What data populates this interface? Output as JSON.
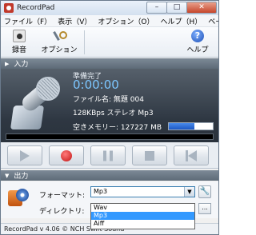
{
  "window": {
    "title": "RecordPad",
    "controls": {
      "minimize": "–",
      "maximize": "□",
      "close": "✕"
    }
  },
  "menu": [
    "ファイル（F）",
    "表示（V）",
    "オプション（O）",
    "ヘルプ（H）",
    "ベータ"
  ],
  "toolbar": {
    "record_label": "録音",
    "options_label": "オプション",
    "help_label": "ヘルプ",
    "help_glyph": "?"
  },
  "input": {
    "header": "入力",
    "status": "準備完了",
    "time": "0:00:00",
    "filename": "ファイル名: 無題 004",
    "format": "128KBps ステレオ Mp3",
    "free_memory": "空きメモリー: 127227 MB",
    "level_fraction": 0.58
  },
  "output": {
    "header": "出力",
    "format_label": "フォーマット:",
    "format_value": "Mp3",
    "directory_label": "ディレクトリ:",
    "directory_value": "",
    "browse_label": "...",
    "wrench_glyph": "🔧",
    "select_arrow": "▼",
    "format_options": [
      "Wav",
      "Mp3",
      "Aiff"
    ],
    "selected_option": "Mp3"
  },
  "statusbar": {
    "text": "RecordPad v 4.06 © NCH Swift Sound"
  },
  "colors": {
    "accent": "#3399ff",
    "time": "#7cc6ff",
    "record": "#c21414"
  },
  "icons": {
    "record": "record-icon",
    "options": "options-icon",
    "help": "help-icon",
    "play": "play-icon",
    "rec": "record-dot-icon",
    "pause": "pause-icon",
    "stop": "stop-icon",
    "rewind": "rewind-icon"
  }
}
